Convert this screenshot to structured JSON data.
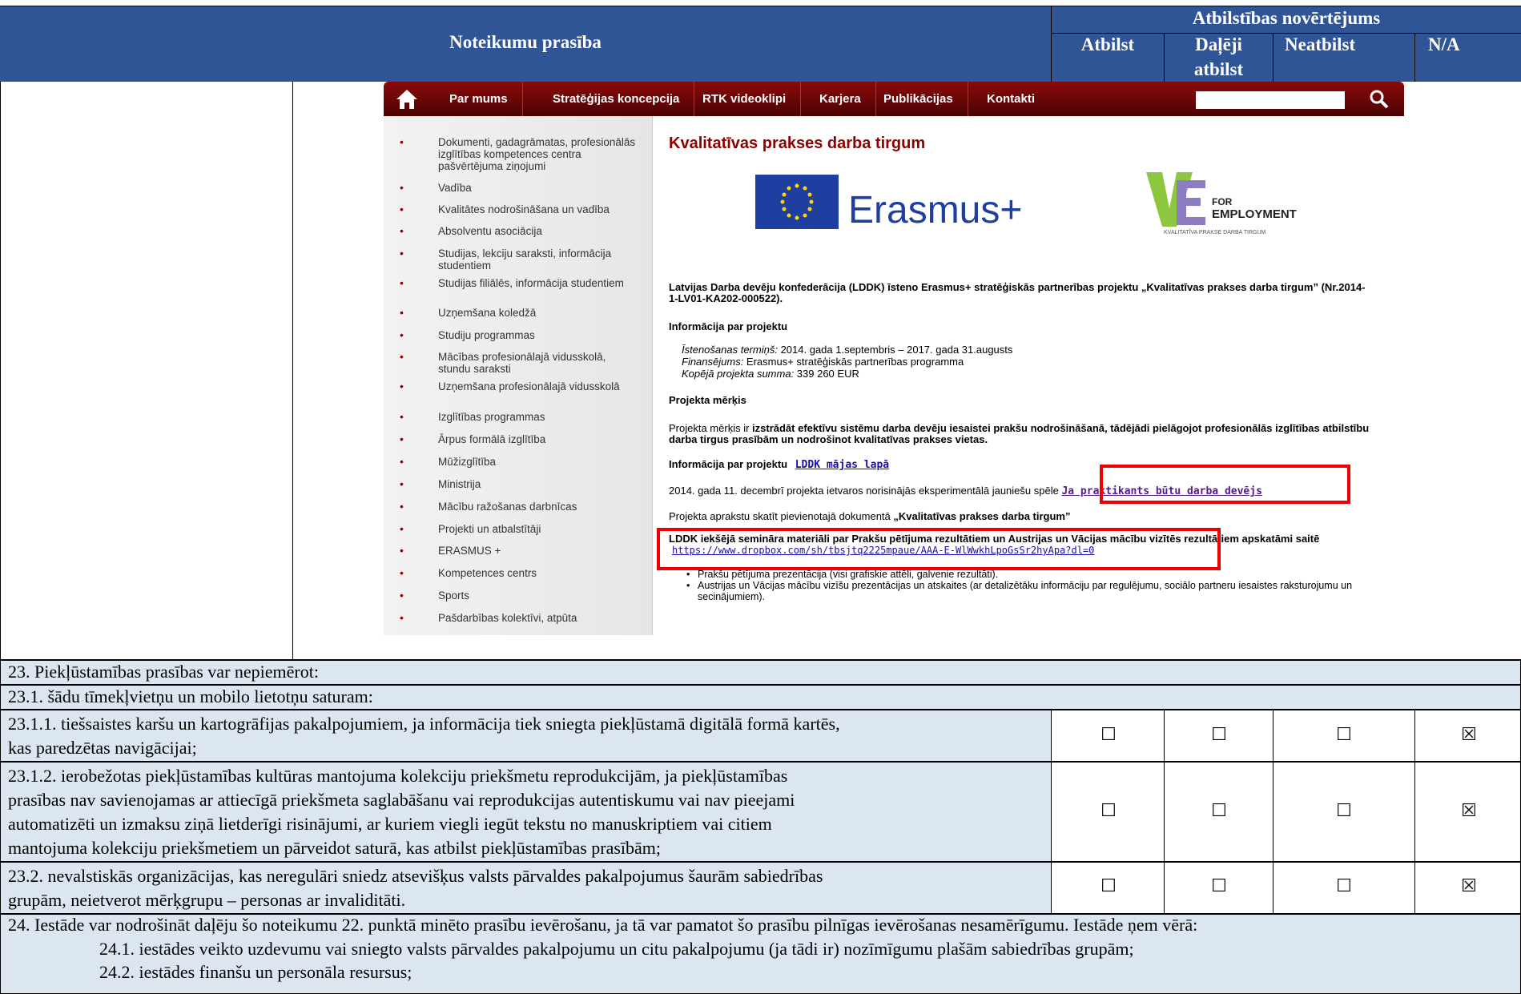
{
  "header": {
    "rule": "Noteikumu prasība",
    "assessment": "Atbilstības novērtējums",
    "col1": "Atbilst",
    "col2a": "Daļēji",
    "col2b": "atbilst",
    "col3": "Neatbilst",
    "col4": "N/A"
  },
  "website": {
    "nav": [
      "Par mums",
      "Stratēģijas koncepcija",
      "RTK videoklipi",
      "Karjera",
      "Publikācijas",
      "Kontakti"
    ],
    "menu": [
      "Dokumenti, gadagrāmatas, profesionālās izglītības kompetences centra pašvērtējuma ziņojumi",
      "Vadība",
      "Kvalitātes nodrošināšana un vadība",
      "Absolventu asociācija",
      "Studijas, lekciju saraksti, informācija studentiem",
      "Studijas filiālēs, informācija studentiem",
      "Uzņemšana koledžā",
      "Studiju programmas",
      "Mācības profesionālajā vidusskolā, stundu saraksti",
      "Uzņemšana profesionālajā vidusskolā",
      "Izglītības programmas",
      "Ārpus formālā izglītība",
      "Mūžizglītība",
      "Ministrija",
      "Mācību ražošanas darbnīcas",
      "Projekti un atbalstītāji",
      "ERASMUS +",
      "Kompetences centrs",
      "Sports",
      "Pašdarbības kolektīvi, atpūta"
    ],
    "title": "Kvalitatīvas prakses darba tirgum",
    "erasmus": "Erasmus+",
    "vet_for": "FOR",
    "vet_employment": "EMPLOYMENT",
    "vet_sub": "KVALITATĪVA PRAKSE DARBA TIRGUM",
    "intro": "Latvijas Darba devēju konfederācija (LDDK) īsteno Erasmus+ stratēģiskās partnerības projektu „Kvalitatīvas prakses darba tirgum” (Nr.2014-1-LV01-KA202-000522).",
    "info_heading": "Informācija par projektu",
    "term_label": "Īstenošanas termiņš:",
    "term_value": " 2014. gada 1.septembris – 2017. gada 31.augusts",
    "fin_label": "Finansējums:",
    "fin_value": " Erasmus+ stratēģiskās partnerības programma",
    "sum_label": "Kopējā projekta summa:",
    "sum_value": " 339 260 EUR",
    "goal_heading": "Projekta mērķis",
    "goal_pre": "Projekta mērķis ir ",
    "goal_bold": "izstrādāt efektīvu sistēmu darba devēju iesaistei prakšu nodrošināšanā, tādējādi pielāgojot profesionālās izglītības atbilstību darba tirgus prasībām un nodrošinot kvalitatīvas prakses vietas.",
    "info2_label": "Informācija par projektu",
    "info2_link": "LDDK mājas lapā",
    "event_text": "2014. gada 11. decembrī projekta ietvaros norisinājās eksperimentālā jauniešu spēle",
    "event_link": "Ja praktikants būtu darba devējs",
    "doc_text": "Projekta aprakstu skatīt pievienotajā dokumentā ",
    "doc_bold": "„Kvalitatīvas prakses darba tirgum”",
    "sem_text": "LDDK iekšējā semināra materiāli par Prakšu pētījuma rezultātiem un Austrijas un Vācijas mācību vizītēs rezultātiem apskatāmi saitē",
    "sem_link": "https://www.dropbox.com/sh/tbsjtq2225mpaue/AAA-E-WlWwkhLpoGsSr2hyApa?dl=0",
    "bullet1": "Prakšu pētījuma prezentācija (visi grafiskie attēli, galvenie rezultāti).",
    "bullet2": "Austrijas un Vācijas mācību vizīšu prezentācijas un atskaites (ar detalizētāku informāciju par regulējumu, sociālo partneru iesaistes raksturojumu un secinājumiem)."
  },
  "rows": {
    "r23": "23. Piekļūstamības prasības var nepiemērot:",
    "r231": "23.1. šādu tīmekļvietņu un mobilo lietotņu saturam:",
    "r2311a": "23.1.1. tiešsaistes karšu un kartogrāfijas pakalpojumiem, ja informācija tiek sniegta piekļūstamā digitālā formā kartēs,",
    "r2311b": "kas paredzētas navigācijai;",
    "r2312a": "23.1.2. ierobežotas piekļūstamības kultūras mantojuma kolekciju priekšmetu reprodukcijām, ja piekļūstamības",
    "r2312b": "prasības nav savienojamas ar attiecīgā priekšmeta saglabāšanu vai reprodukcijas autentiskumu vai nav pieejami",
    "r2312c": "automatizēti un izmaksu ziņā lietderīgi risinājumi, ar kuriem viegli iegūt tekstu no manuskriptiem vai citiem",
    "r2312d": "mantojuma kolekciju priekšmetiem un pārveidot saturā, kas atbilst piekļūstamības prasībām;",
    "r232a": "23.2. nevalstiskās organizācijas, kas neregulāri sniedz atsevišķus valsts pārvaldes pakalpojumus šaurām sabiedrības",
    "r232b": "grupām, neietverot mērķgrupu – personas ar invaliditāti.",
    "r24": "24. Iestāde var nodrošināt daļēju šo noteikumu 22. punktā minēto prasību ievērošanu, ja tā var pamatot šo prasību pilnīgas ievērošanas nesamērīgumu. Iestāde ņem vērā:",
    "r241": "24.1. iestādes veikto uzdevumu vai sniegto valsts pārvaldes pakalpojumu un citu pakalpojumu (ja tādi ir) nozīmīgumu plašām sabiedrības grupām;",
    "r242": "24.2. iestādes finanšu un personāla resursus;"
  },
  "checkboxes": {
    "unchecked": "☐",
    "checked": "☒"
  }
}
